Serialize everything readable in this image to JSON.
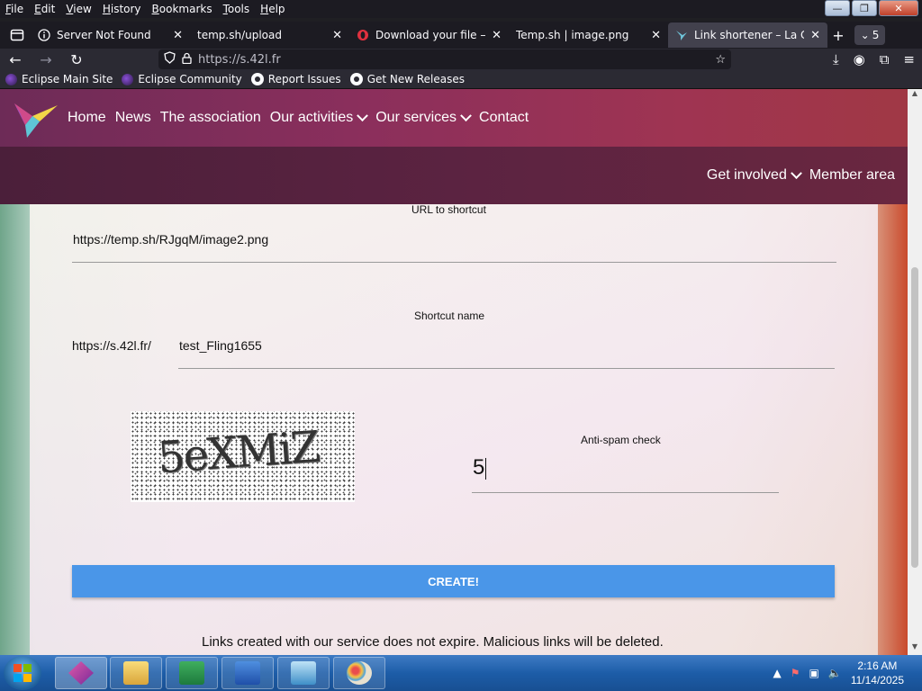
{
  "menubar": {
    "items": [
      "File",
      "Edit",
      "View",
      "History",
      "Bookmarks",
      "Tools",
      "Help"
    ]
  },
  "window_controls": {
    "minimize": "—",
    "maximize": "❐",
    "close": "✕"
  },
  "tabs": [
    {
      "label": "Server Not Found",
      "icon": "info-icon"
    },
    {
      "label": "temp.sh/upload",
      "icon": "none"
    },
    {
      "label": "Download your file — (",
      "icon": "opera-icon"
    },
    {
      "label": "Temp.sh | image.png",
      "icon": "none"
    },
    {
      "label": "Link shortener – La Cor",
      "icon": "hummingbird-icon",
      "active": true
    }
  ],
  "tab_count": "5",
  "address_bar": {
    "url": "https://s.42l.fr"
  },
  "bookmarks": [
    {
      "label": "Eclipse Main Site",
      "icon": "eclipse-icon"
    },
    {
      "label": "Eclipse Community",
      "icon": "eclipse-icon"
    },
    {
      "label": "Report Issues",
      "icon": "github-icon"
    },
    {
      "label": "Get New Releases",
      "icon": "github-icon"
    }
  ],
  "site_nav": {
    "main": [
      "Home",
      "News",
      "The association",
      "Our activities",
      "Our services",
      "Contact"
    ],
    "secondary": [
      "Get involved",
      "Member area"
    ]
  },
  "form": {
    "url_label": "URL to shortcut",
    "url_value": "https://temp.sh/RJgqM/image2.png",
    "shortcut_label": "Shortcut name",
    "shortcut_prefix": "https://s.42l.fr/",
    "shortcut_value": "test_Fling1655",
    "captcha_text": "5eXMiZ",
    "antispam_label": "Anti-spam check",
    "antispam_value": "5",
    "create_label": "CREATE!",
    "footnote": "Links created with our service does not expire. Malicious links will be deleted."
  },
  "taskbar": {
    "time": "2:16 AM",
    "date": "11/14/2025"
  },
  "colors": {
    "header_primary": "#8b2f5c",
    "header_secondary": "#5b2341",
    "button": "#4a96e8"
  }
}
